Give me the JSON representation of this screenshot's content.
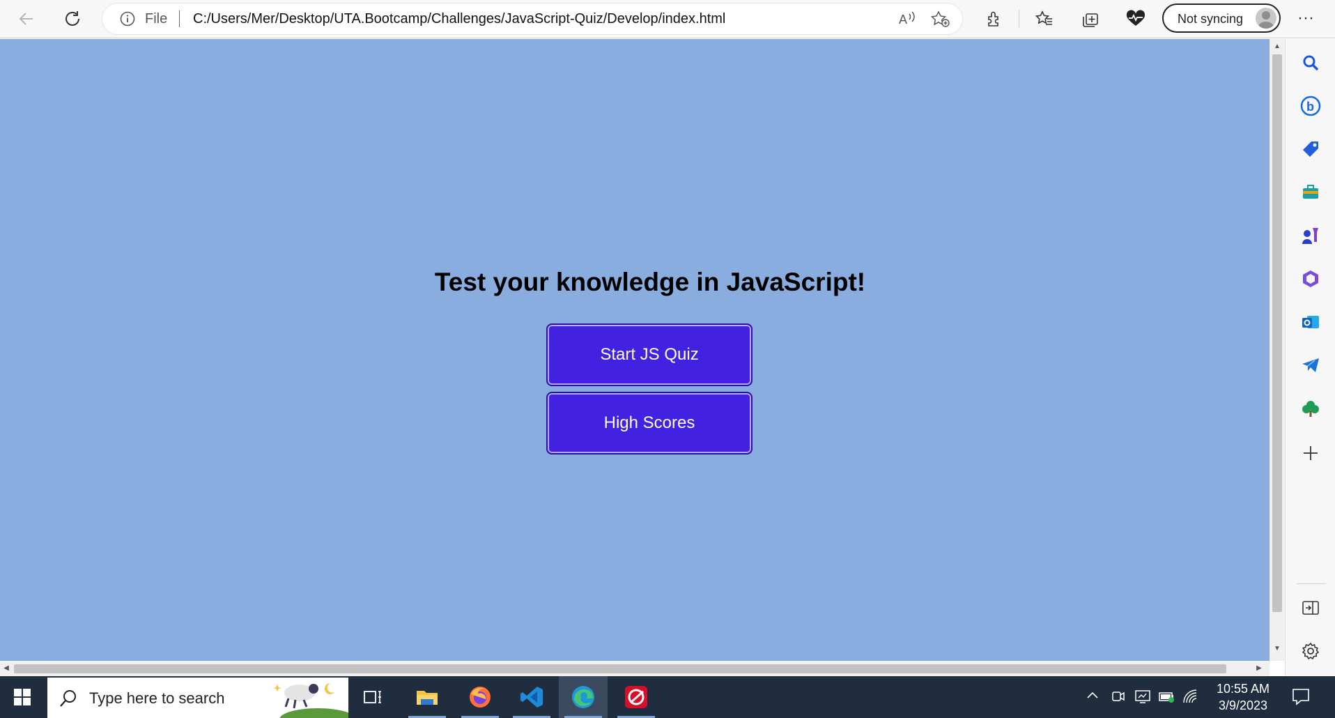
{
  "browser": {
    "address_bar": {
      "scheme_label": "File",
      "url": "C:/Users/Mer/Desktop/UTA.Bootcamp/Challenges/JavaScript-Quiz/Develop/index.html"
    },
    "sync_label": "Not syncing",
    "icons": [
      "back-icon",
      "refresh-icon",
      "info-icon",
      "read-aloud-icon",
      "add-favorite-icon",
      "extensions-icon",
      "favorites-icon",
      "collections-icon",
      "browser-essentials-icon",
      "more-icon"
    ]
  },
  "page": {
    "title": "Test your knowledge in JavaScript!",
    "start_button": "Start JS Quiz",
    "scores_button": "High Scores",
    "background_color": "#8aade0",
    "button_color": "#4221e0"
  },
  "sidebar": {
    "icons": [
      "search-icon",
      "bing-icon",
      "shopping-icon",
      "tools-icon",
      "games-icon",
      "office-icon",
      "outlook-icon",
      "telegram-icon",
      "tree-icon",
      "add-icon",
      "split-screen-icon",
      "settings-icon"
    ]
  },
  "taskbar": {
    "search_placeholder": "Type here to search",
    "time": "10:55 AM",
    "date": "3/9/2023",
    "apps": [
      "task-view-icon",
      "file-explorer-icon",
      "firefox-icon",
      "vscode-icon",
      "edge-icon",
      "trend-micro-icon"
    ]
  }
}
